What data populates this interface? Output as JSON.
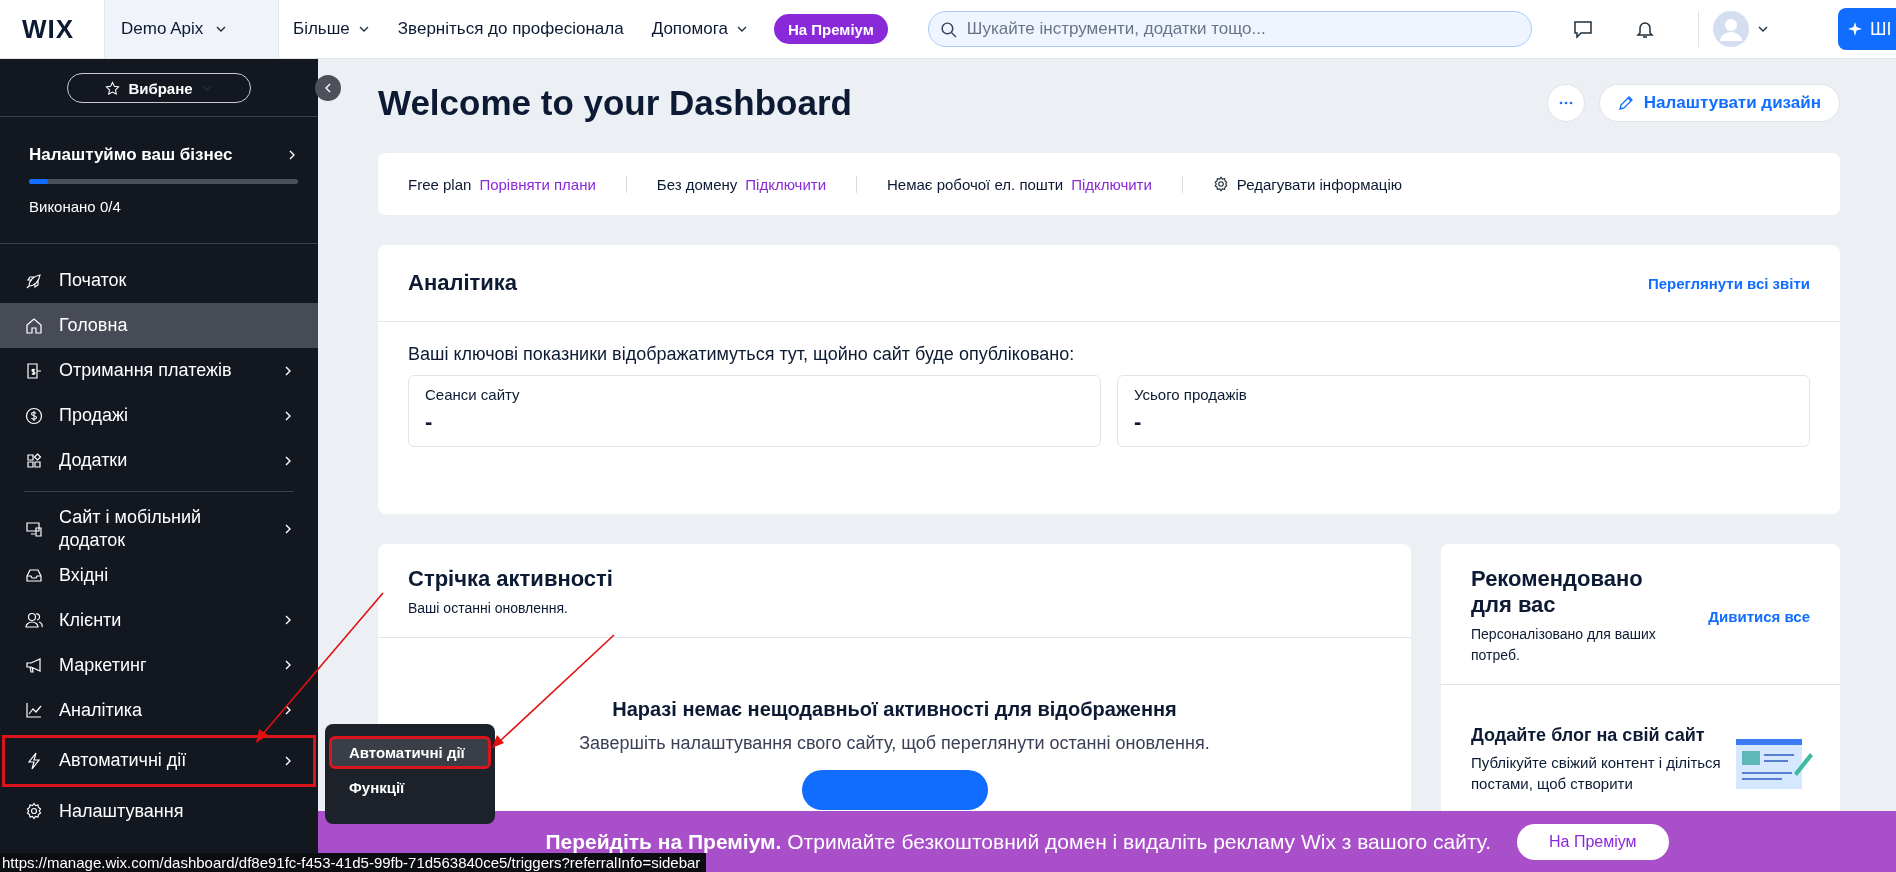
{
  "topbar": {
    "logo": "WIX",
    "site": "Demo Apix",
    "nav": [
      {
        "label": "Більше",
        "dropdown": true
      },
      {
        "label": "Зверніться до професіонала",
        "dropdown": false
      },
      {
        "label": "Допомога",
        "dropdown": true
      }
    ],
    "premium": "На Преміум",
    "search": {
      "placeholder": "Шукайте інструменти, додатки тощо..."
    },
    "create": "ШІ"
  },
  "sidebar": {
    "favorites": "Вибране",
    "setup": {
      "title": "Налаштуймо ваш бізнес",
      "level": 0.07,
      "progress": "Виконано 0/4"
    },
    "groups": [
      [
        {
          "label": "Початок",
          "kind": "rocket",
          "selected": false,
          "submenu": false,
          "annotated": false
        },
        {
          "label": "Головна",
          "kind": "home",
          "selected": true,
          "submenu": false,
          "annotated": false
        },
        {
          "label": "Отримання платежів",
          "kind": "receipt",
          "selected": false,
          "submenu": true,
          "annotated": false
        },
        {
          "label": "Продажі",
          "kind": "dollar",
          "selected": false,
          "submenu": true,
          "annotated": false
        },
        {
          "label": "Додатки",
          "kind": "apps",
          "selected": false,
          "submenu": true,
          "annotated": false
        }
      ],
      [
        {
          "label": "Сайт і мобільний додаток",
          "kind": "devices",
          "selected": false,
          "submenu": true,
          "annotated": false
        },
        {
          "label": "Вхідні",
          "kind": "inbox",
          "selected": false,
          "submenu": false,
          "annotated": false
        },
        {
          "label": "Клієнти",
          "kind": "people",
          "selected": false,
          "submenu": true,
          "annotated": false
        },
        {
          "label": "Маркетинг",
          "kind": "megaphone",
          "selected": false,
          "submenu": true,
          "annotated": false
        },
        {
          "label": "Аналітика",
          "kind": "chart",
          "selected": false,
          "submenu": true,
          "annotated": false
        },
        {
          "label": "Автоматичні дії",
          "kind": "bolt",
          "selected": false,
          "submenu": true,
          "annotated": true
        },
        {
          "label": "Налаштування",
          "kind": "gear",
          "selected": false,
          "submenu": false,
          "annotated": false
        }
      ]
    ],
    "popup": [
      {
        "label": "Автоматичні дії",
        "selected": true,
        "annotated": true
      },
      {
        "label": "Функції",
        "selected": false,
        "annotated": false
      }
    ]
  },
  "dashboard": {
    "title": "Welcome to your Dashboard",
    "customize": "Налаштувати дизайн",
    "info": [
      {
        "label": "Free plan",
        "link": "Порівняти плани"
      },
      {
        "label": "Без домену",
        "link": "Підключити"
      },
      {
        "label": "Немає робочої ел. пошти",
        "link": "Підключити"
      }
    ],
    "edit": "Редагувати інформацію",
    "analytics": {
      "title": "Аналітика",
      "link": "Переглянути всі звіти",
      "note": "Ваші ключові показники відображатимуться тут, щойно сайт буде опубліковано:",
      "metrics": [
        {
          "label": "Сеанси сайту",
          "value": "-"
        },
        {
          "label": "Усього продажів",
          "value": "-"
        }
      ]
    },
    "activity": {
      "title": "Стрічка активності",
      "subtitle": "Ваші останні оновлення.",
      "empty_title": "Наразі немає нещодавньої активності для відображення",
      "empty_text": "Завершіть налаштування свого сайту, щоб переглянути останні оновлення."
    },
    "recommended": {
      "title": "Рекомендовано для вас",
      "link": "Дивитися все",
      "subtitle": "Персоналізовано для ваших потреб.",
      "item_title": "Додайте блог на свій сайт",
      "item_text": "Публікуйте свіжий контент і діліться постами, щоб створити"
    }
  },
  "banner": {
    "bold": "Перейдіть на Преміум.",
    "text": "Отримайте безкоштовний домен і видаліть рекламу Wix з вашого сайту.",
    "button": "На Преміум"
  },
  "status_url": "https://manage.wix.com/dashboard/df8e91fc-f453-41d5-99fb-71d563840ce5/triggers?referralInfo=sidebar"
}
